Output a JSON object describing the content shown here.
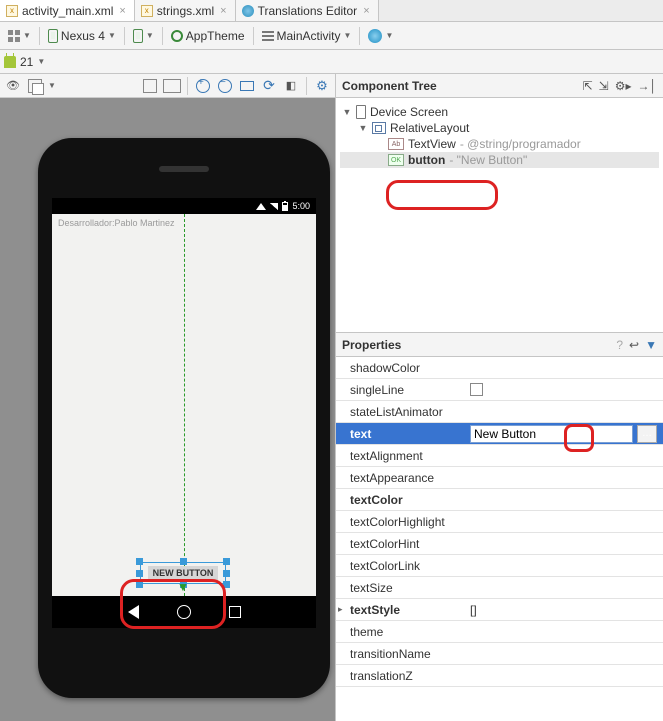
{
  "tabs": [
    {
      "label": "activity_main.xml",
      "icon": "xml",
      "active": true
    },
    {
      "label": "strings.xml",
      "icon": "xml",
      "active": false
    },
    {
      "label": "Translations Editor",
      "icon": "globe",
      "active": false
    }
  ],
  "toolbar": {
    "device": "Nexus 4",
    "theme": "AppTheme",
    "activity": "MainActivity",
    "api": "21"
  },
  "preview": {
    "status_time": "5:00",
    "textview_text": "Desarrollador:Pablo Martinez",
    "button_text": "NEW BUTTON"
  },
  "component_tree": {
    "title": "Component Tree",
    "root": "Device Screen",
    "layout": {
      "name": "RelativeLayout"
    },
    "textview": {
      "name": "TextView",
      "ref": "@string/programador"
    },
    "button": {
      "name": "button",
      "val": "\"New Button\""
    }
  },
  "properties": {
    "title": "Properties",
    "rows": {
      "shadowColor": "shadowColor",
      "singleLine": "singleLine",
      "stateListAnimator": "stateListAnimator",
      "text": "text",
      "textAlignment": "textAlignment",
      "textAppearance": "textAppearance",
      "textColor": "textColor",
      "textColorHighlight": "textColorHighlight",
      "textColorHint": "textColorHint",
      "textColorLink": "textColorLink",
      "textSize": "textSize",
      "textStyle": "textStyle",
      "theme": "theme",
      "transitionName": "transitionName",
      "translationZ": "translationZ"
    },
    "text_value": "New Button",
    "textStyle_value": "[]"
  }
}
